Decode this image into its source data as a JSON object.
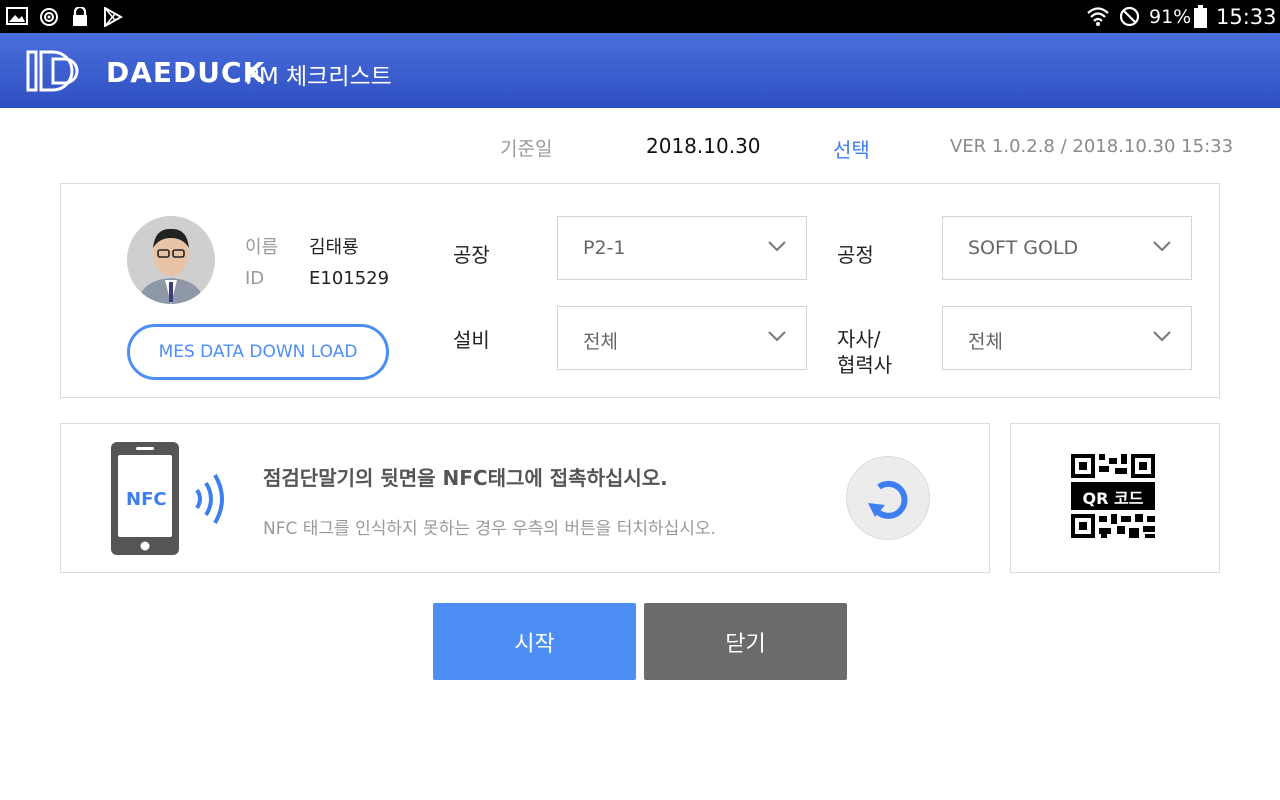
{
  "status_bar": {
    "icons": [
      "image-icon",
      "sync-icon",
      "lock-icon",
      "play-store-icon",
      "wifi-icon",
      "do-not-disturb-icon",
      "battery-icon"
    ],
    "battery": "91%",
    "time": "15:33"
  },
  "header": {
    "brand": "DAEDUCK",
    "title": "PM 체크리스트",
    "color": "#3a5ccf"
  },
  "ref_row": {
    "date_label": "기준일",
    "date_value": "2018.10.30",
    "select_link": "선택",
    "version": "VER 1.0.2.8 / 2018.10.30 15:33"
  },
  "user": {
    "name_label": "이름",
    "name": "김태룡",
    "id_label": "ID",
    "id": "E101529",
    "mes_button": "MES DATA DOWN LOAD"
  },
  "filters": {
    "factory_label": "공장",
    "factory_value": "P2-1",
    "process_label": "공정",
    "process_value": "SOFT GOLD",
    "equipment_label": "설비",
    "equipment_value": "전체",
    "partner_label_1": "자사/",
    "partner_label_2": "협력사",
    "partner_value": "전체"
  },
  "nfc": {
    "phone_label": "NFC",
    "message": "점검단말기의 뒷면을 NFC태그에 접촉하십시오.",
    "hint": "NFC 태그를 인식하지 못하는 경우 우측의 버튼을 터치하십시오."
  },
  "qr": {
    "label": "QR 코드"
  },
  "actions": {
    "start": "시작",
    "close": "닫기",
    "start_color": "#4d8ef5",
    "close_color": "#6b6b6b"
  }
}
